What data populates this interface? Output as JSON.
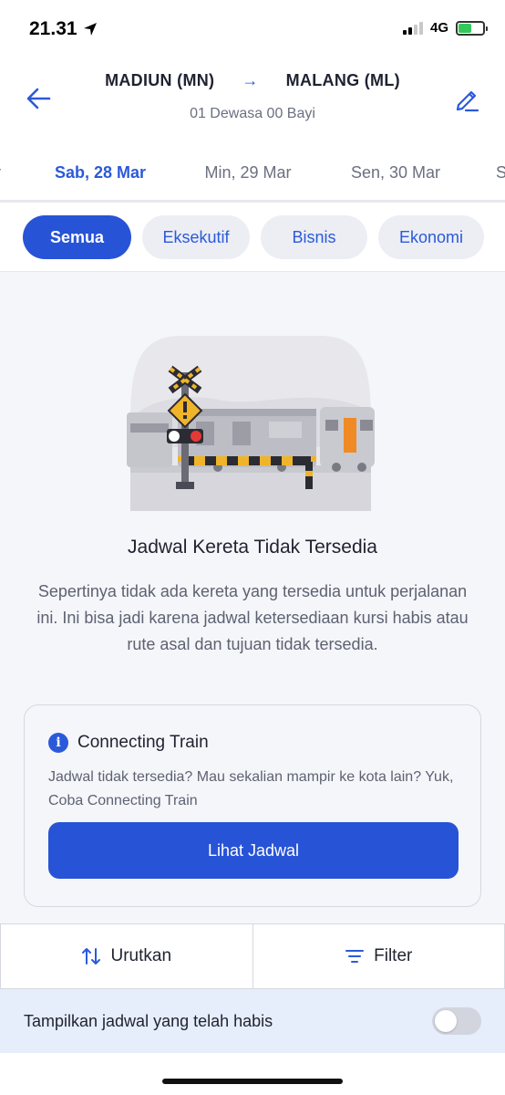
{
  "status_bar": {
    "time": "21.31",
    "network": "4G"
  },
  "header": {
    "origin": "MADIUN (MN)",
    "destination": "MALANG (ML)",
    "route_arrow": "→",
    "passengers": "01 Dewasa 00 Bayi"
  },
  "date_tabs": [
    {
      "label": "Sab, 28 Mar",
      "active": true
    },
    {
      "label": "Min, 29 Mar",
      "active": false
    },
    {
      "label": "Sen, 30 Mar",
      "active": false
    }
  ],
  "class_filters": [
    {
      "label": "Semua",
      "active": true
    },
    {
      "label": "Eksekutif",
      "active": false
    },
    {
      "label": "Bisnis",
      "active": false
    },
    {
      "label": "Ekonomi",
      "active": false
    }
  ],
  "empty_state": {
    "title": "Jadwal Kereta Tidak Tersedia",
    "description": "Sepertinya tidak ada kereta yang tersedia untuk perjalanan ini. Ini bisa jadi karena jadwal ketersediaan kursi habis atau rute asal dan tujuan tidak tersedia."
  },
  "connecting_train": {
    "title": "Connecting Train",
    "description": "Jadwal tidak tersedia? Mau sekalian mampir ke kota lain? Yuk, Coba Connecting Train",
    "button_label": "Lihat Jadwal"
  },
  "actions": {
    "sort_label": "Urutkan",
    "filter_label": "Filter"
  },
  "toggle": {
    "label": "Tampilkan jadwal yang telah habis",
    "on": false
  },
  "colors": {
    "primary": "#2753d6",
    "accent": "#2b5ad9",
    "toggle_row_bg": "#e6edfb",
    "battery": "#34c759"
  }
}
